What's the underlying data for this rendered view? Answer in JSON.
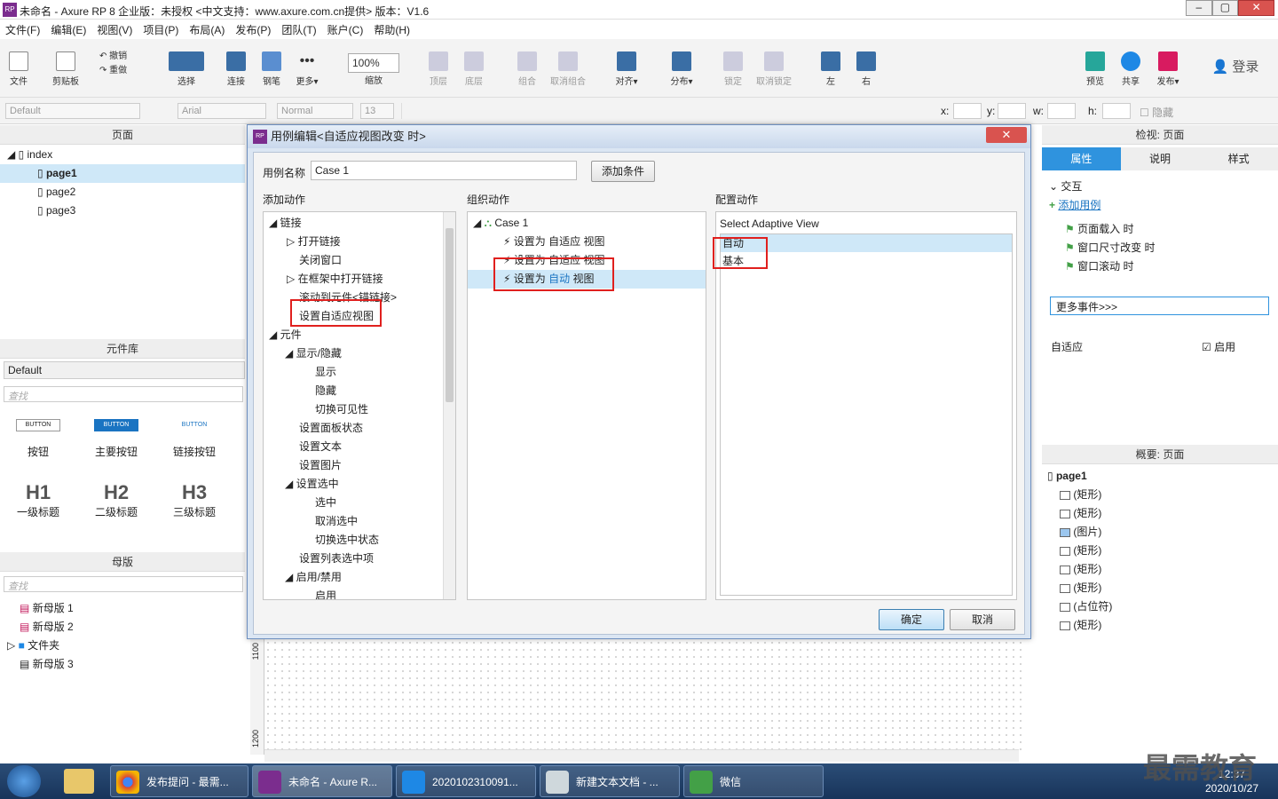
{
  "window": {
    "title": "未命名 - Axure RP 8 企业版：未授权    <中文支持：www.axure.com.cn提供> 版本：V1.6"
  },
  "menu": [
    "文件(F)",
    "编辑(E)",
    "视图(V)",
    "项目(P)",
    "布局(A)",
    "发布(P)",
    "团队(T)",
    "账户(C)",
    "帮助(H)"
  ],
  "toolbar": {
    "file": "文件",
    "clipboard": "剪贴板",
    "undo": "撤销",
    "redo": "重做",
    "select": "选择",
    "connect": "连接",
    "pen": "钢笔",
    "more": "更多▾",
    "zoom": "100%",
    "zoom_label": "缩放",
    "top": "顶层",
    "bottom": "底层",
    "group": "组合",
    "ungroup": "取消组合",
    "align": "对齐▾",
    "distribute": "分布▾",
    "lock": "锁定",
    "unlock": "取消锁定",
    "left": "左",
    "right": "右",
    "preview": "预览",
    "share": "共享",
    "publish": "发布▾",
    "login": "登录"
  },
  "format": {
    "style": "Default",
    "font": "Arial",
    "weight": "Normal",
    "size": "13",
    "x": "x:",
    "y": "y:",
    "w": "w:",
    "h": "h:",
    "hide": "隐藏"
  },
  "pages": {
    "title": "页面",
    "root": "index",
    "items": [
      "page1",
      "page2",
      "page3"
    ]
  },
  "library": {
    "title": "元件库",
    "selected": "Default",
    "search": "查找",
    "widgets": [
      {
        "icon": "BUTTON",
        "label": "按钮"
      },
      {
        "icon": "BUTTON",
        "label": "主要按钮"
      },
      {
        "icon": "BUTTON",
        "label": "链接按钮"
      },
      {
        "icon": "H1",
        "label": "一级标题"
      },
      {
        "icon": "H2",
        "label": "二级标题"
      },
      {
        "icon": "H3",
        "label": "三级标题"
      }
    ]
  },
  "masters": {
    "title": "母版",
    "search": "查找",
    "items": [
      "新母版 1",
      "新母版 2",
      "文件夹",
      "新母版 3"
    ]
  },
  "dialog": {
    "title": "用例编辑<自适应视图改变 时>",
    "case_label": "用例名称",
    "case_value": "Case 1",
    "add_condition": "添加条件",
    "add_action": "添加动作",
    "organize": "组织动作",
    "configure": "配置动作",
    "actions": [
      "链接",
      "打开链接",
      "关闭窗口",
      "在框架中打开链接",
      "滚动到元件<锚链接>",
      "设置自适应视图",
      "元件",
      "显示/隐藏",
      "显示",
      "隐藏",
      "切换可见性",
      "设置面板状态",
      "设置文本",
      "设置图片",
      "设置选中",
      "选中",
      "取消选中",
      "切换选中状态",
      "设置列表选中项",
      "启用/禁用",
      "启用"
    ],
    "case_name": "Case 1",
    "org_items": [
      "设置为 自适应 视图",
      "设置为 自适应 视图",
      "设置为 "
    ],
    "org_auto": "自动",
    "org_view": " 视图",
    "config_title": "Select Adaptive View",
    "config_items": [
      "自动",
      "基本"
    ],
    "ok": "确定",
    "cancel": "取消"
  },
  "inspector": {
    "title": "检视: 页面",
    "tabs": [
      "属性",
      "说明",
      "样式"
    ],
    "interaction": "交互",
    "add_case": "添加用例",
    "events": [
      "页面载入 时",
      "窗口尺寸改变 时",
      "窗口滚动 时"
    ],
    "more_events": "更多事件>>>",
    "adaptive": "自适应",
    "enable": "启用"
  },
  "outline": {
    "title": "概要: 页面",
    "page": "page1",
    "items": [
      "(矩形)",
      "(矩形)",
      "(图片)",
      "(矩形)",
      "(矩形)",
      "(矩形)",
      "(占位符)",
      "(矩形)"
    ]
  },
  "ruler": {
    "m1": "1100",
    "m2": "1200"
  },
  "taskbar": {
    "items": [
      "发布提问 - 最需...",
      "未命名 - Axure R...",
      "2020102310091...",
      "新建文本文档 - ...",
      "微信"
    ],
    "time": "12:37",
    "date": "2020/10/27",
    "watermark": "最需教育"
  }
}
